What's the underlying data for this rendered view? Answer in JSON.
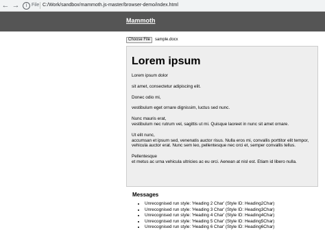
{
  "browser": {
    "back_icon": "back-arrow-icon",
    "forward_icon": "forward-arrow-icon",
    "info_icon": "info-icon",
    "protocol_label": "File",
    "url": "C:/Work/sandbox/mammoth.js-master/browser-demo/index.html"
  },
  "header": {
    "title": "Mammoth"
  },
  "file_input": {
    "button_label": "Choose File",
    "file_name": "sample.docx"
  },
  "output": {
    "heading": "Lorem ipsum",
    "paragraphs": [
      "Lorem ipsum dolor",
      "sit amet, consectetur adipiscing elit.",
      "Donec odio mi,",
      "vestibulum eget ornare dignissim, luctus sed nunc.",
      "Nunc mauris erat,\nvestibulum nec rutrum vel, sagittis ut mi. Quisque laoreet in nunc sit amet ornare.",
      "Ut elit nunc,\naccumsan et ipsum sed, venenatis auctor risus. Nulla eros mi, convallis porttitor elit tempor, vehicula auctor erat. Nunc sem leo, pellentesque nec orci et, semper convallis tellus.",
      "Pellentesque\net metus ac urna vehicula ultricies ac eu orci. Aenean at nisl est. Etiam id libero nulla."
    ]
  },
  "messages": {
    "title": "Messages",
    "items": [
      "Unrecognised run style: 'Heading 2 Char' (Style ID: Heading2Char)",
      "Unrecognised run style: 'Heading 3 Char' (Style ID: Heading3Char)",
      "Unrecognised run style: 'Heading 4 Char' (Style ID: Heading4Char)",
      "Unrecognised run style: 'Heading 5 Char' (Style ID: Heading5Char)",
      "Unrecognised run style: 'Heading 6 Char' (Style ID: Heading6Char)"
    ]
  }
}
